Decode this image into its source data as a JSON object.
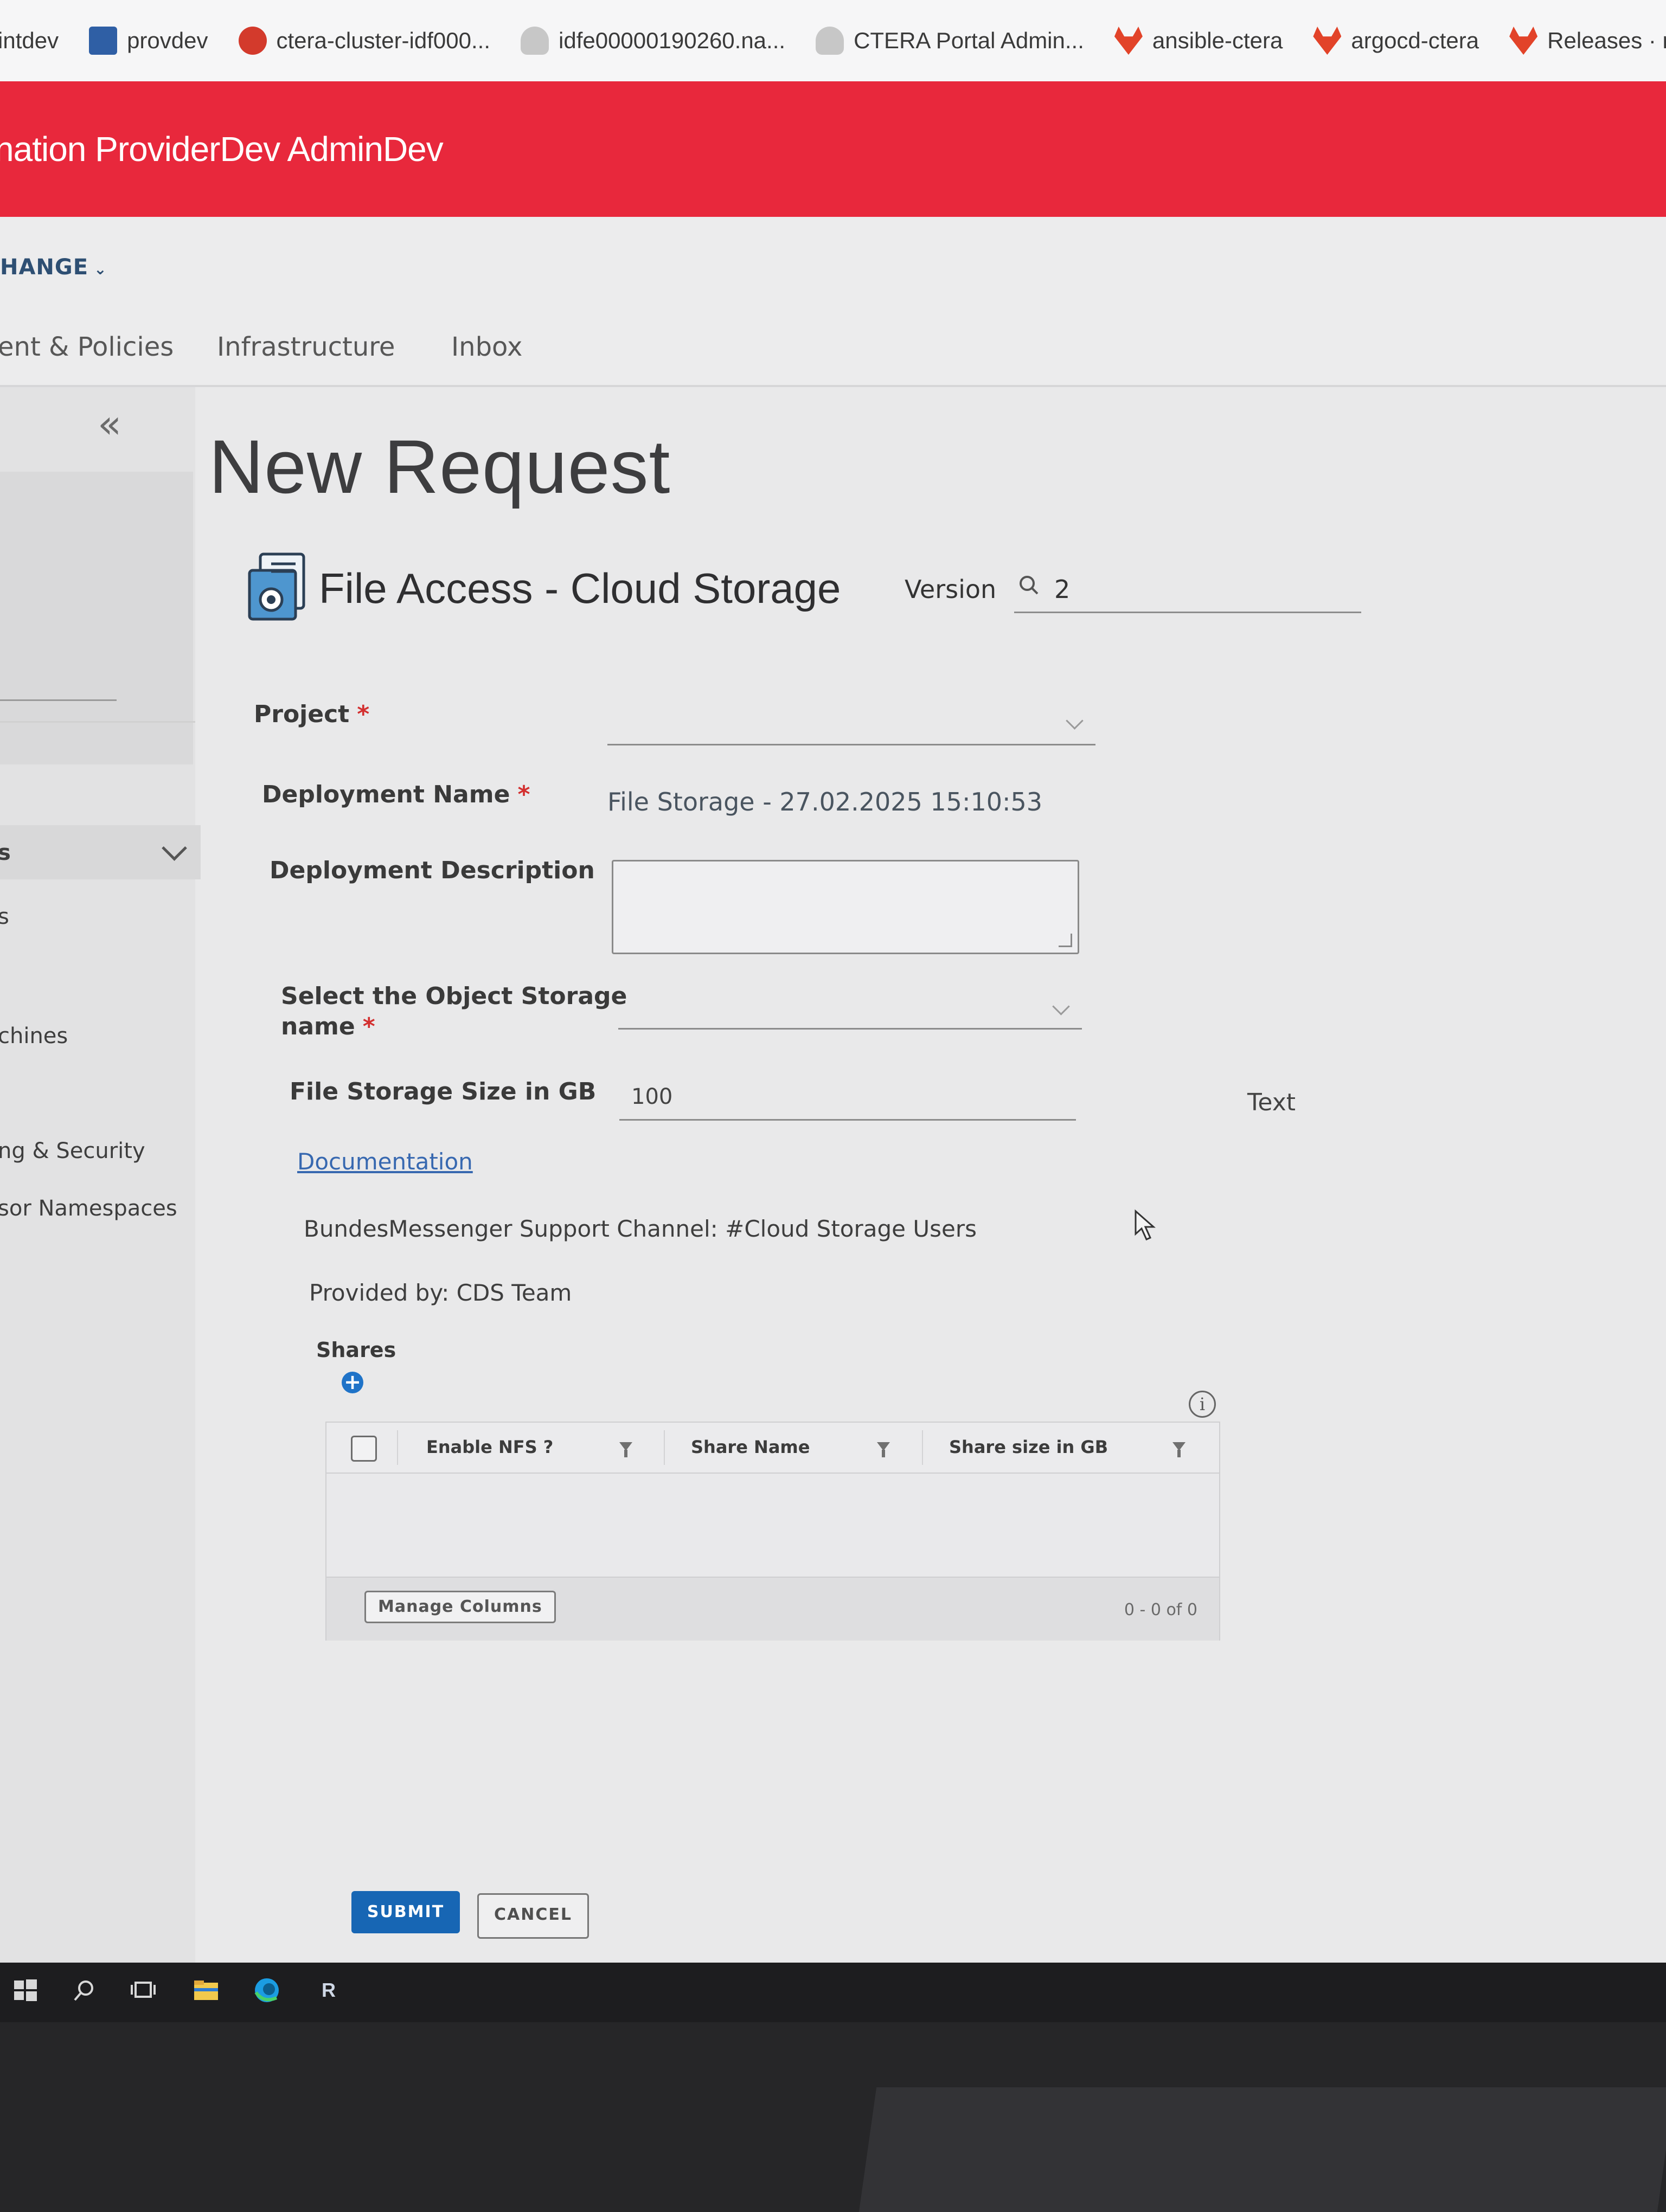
{
  "bookmarks": [
    {
      "label": "intdev",
      "icon": "none"
    },
    {
      "label": "provdev",
      "icon": "blue-square-icon"
    },
    {
      "label": "ctera-cluster-idf000...",
      "icon": "red-circle-icon"
    },
    {
      "label": "idfe00000190260.na...",
      "icon": "cloud-icon"
    },
    {
      "label": "CTERA Portal Admin...",
      "icon": "cloud-icon"
    },
    {
      "label": "ansible-ctera",
      "icon": "gitlab-fox-icon"
    },
    {
      "label": "argocd-ctera",
      "icon": "gitlab-fox-icon"
    },
    {
      "label": "Releases · mai",
      "icon": "gitlab-fox-icon"
    }
  ],
  "header": {
    "title": "nation ProviderDev AdminDev",
    "change_label": "HANGE",
    "bg_color": "#e8283c"
  },
  "nav": {
    "tabs": [
      "ent & Policies",
      "Infrastructure",
      "Inbox"
    ]
  },
  "sidebar": {
    "group_label": "s",
    "items": [
      "s",
      "chines",
      "ng & Security",
      "sor Namespaces"
    ]
  },
  "page": {
    "title": "New Request",
    "catalog_item": "File Access - Cloud Storage",
    "version_label": "Version",
    "version_value": "2"
  },
  "form": {
    "project_label": "Project",
    "project_value": "",
    "deployment_name_label": "Deployment Name",
    "deployment_name_value": "File Storage - 27.02.2025 15:10:53",
    "deployment_description_label": "Deployment Description",
    "deployment_description_value": "",
    "object_storage_label_line1": "Select the Object Storage",
    "object_storage_label_line2": "name",
    "object_storage_value": "",
    "size_label": "File Storage Size in GB",
    "size_value": "100",
    "size_hint": "Text",
    "required_marker": "*",
    "documentation_link": "Documentation",
    "support_text": "BundesMessenger Support Channel: #Cloud Storage Users",
    "provided_by": "Provided by: CDS Team"
  },
  "shares": {
    "label": "Shares",
    "add_symbol": "+",
    "info_symbol": "i",
    "columns": [
      "Enable NFS ?",
      "Share Name",
      "Share size in GB"
    ],
    "rows": [],
    "manage_columns_label": "Manage Columns",
    "pager_text": "0 - 0 of 0"
  },
  "actions": {
    "submit_label": "SUBMIT",
    "cancel_label": "CANCEL",
    "primary_color": "#1766b4"
  },
  "taskbar": {
    "icons": [
      "windows-start-icon",
      "search-icon",
      "task-view-icon",
      "file-explorer-icon",
      "edge-browser-icon",
      "app-icon"
    ],
    "app_letter": "R"
  }
}
